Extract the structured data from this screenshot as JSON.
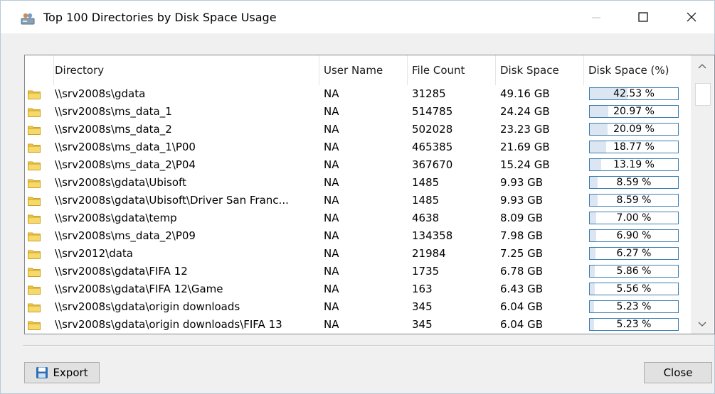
{
  "window": {
    "title": "Top 100 Directories by Disk Space Usage",
    "icon": "disk-users-icon",
    "controls": [
      "minimize-icon",
      "maximize-icon",
      "close-icon"
    ]
  },
  "table": {
    "columns": [
      "Directory",
      "User Name",
      "File Count",
      "Disk Space",
      "Disk Space (%)"
    ],
    "rows": [
      {
        "directory": "\\\\srv2008s\\gdata",
        "user": "NA",
        "files": "31285",
        "space": "49.16 GB",
        "pct": "42.53 %",
        "pct_value": 42.53
      },
      {
        "directory": "\\\\srv2008s\\ms_data_1",
        "user": "NA",
        "files": "514785",
        "space": "24.24 GB",
        "pct": "20.97 %",
        "pct_value": 20.97
      },
      {
        "directory": "\\\\srv2008s\\ms_data_2",
        "user": "NA",
        "files": "502028",
        "space": "23.23 GB",
        "pct": "20.09 %",
        "pct_value": 20.09
      },
      {
        "directory": "\\\\srv2008s\\ms_data_1\\P00",
        "user": "NA",
        "files": "465385",
        "space": "21.69 GB",
        "pct": "18.77 %",
        "pct_value": 18.77
      },
      {
        "directory": "\\\\srv2008s\\ms_data_2\\P04",
        "user": "NA",
        "files": "367670",
        "space": "15.24 GB",
        "pct": "13.19 %",
        "pct_value": 13.19
      },
      {
        "directory": "\\\\srv2008s\\gdata\\Ubisoft",
        "user": "NA",
        "files": "1485",
        "space": "9.93 GB",
        "pct": "8.59 %",
        "pct_value": 8.59
      },
      {
        "directory": "\\\\srv2008s\\gdata\\Ubisoft\\Driver San Franc...",
        "user": "NA",
        "files": "1485",
        "space": "9.93 GB",
        "pct": "8.59 %",
        "pct_value": 8.59
      },
      {
        "directory": "\\\\srv2008s\\gdata\\temp",
        "user": "NA",
        "files": "4638",
        "space": "8.09 GB",
        "pct": "7.00 %",
        "pct_value": 7.0
      },
      {
        "directory": "\\\\srv2008s\\ms_data_2\\P09",
        "user": "NA",
        "files": "134358",
        "space": "7.98 GB",
        "pct": "6.90 %",
        "pct_value": 6.9
      },
      {
        "directory": "\\\\srv2012\\data",
        "user": "NA",
        "files": "21984",
        "space": "7.25 GB",
        "pct": "6.27 %",
        "pct_value": 6.27
      },
      {
        "directory": "\\\\srv2008s\\gdata\\FIFA 12",
        "user": "NA",
        "files": "1735",
        "space": "6.78 GB",
        "pct": "5.86 %",
        "pct_value": 5.86
      },
      {
        "directory": "\\\\srv2008s\\gdata\\FIFA 12\\Game",
        "user": "NA",
        "files": "163",
        "space": "6.43 GB",
        "pct": "5.56 %",
        "pct_value": 5.56
      },
      {
        "directory": "\\\\srv2008s\\gdata\\origin downloads",
        "user": "NA",
        "files": "345",
        "space": "6.04 GB",
        "pct": "5.23 %",
        "pct_value": 5.23
      },
      {
        "directory": "\\\\srv2008s\\gdata\\origin downloads\\FIFA 13",
        "user": "NA",
        "files": "345",
        "space": "6.04 GB",
        "pct": "5.23 %",
        "pct_value": 5.23
      }
    ]
  },
  "footer": {
    "export_label": "Export",
    "close_label": "Close"
  },
  "colors": {
    "bar_border": "#3c7fb1",
    "bar_fill": "#dce6f2",
    "folder": "#f2c94c"
  }
}
